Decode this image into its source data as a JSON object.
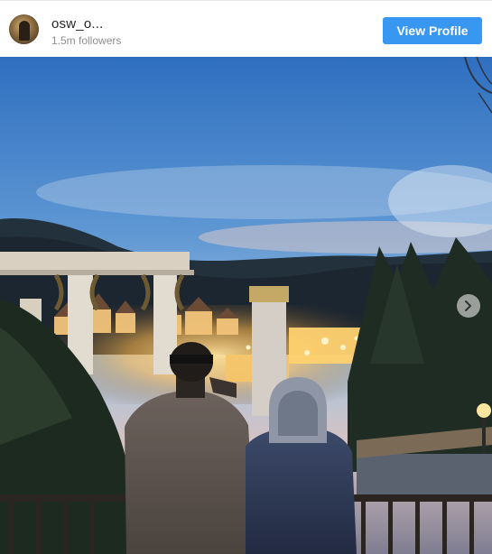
{
  "post": {
    "username": "osw_o...",
    "followers": "1.5m followers",
    "view_profile_label": "View Profile"
  },
  "media": {
    "description_icon": "photo",
    "nav_next_icon": "chevron-right-icon"
  },
  "colors": {
    "button": "#3897f0",
    "username": "#262626",
    "muted": "#8e8e8e"
  }
}
